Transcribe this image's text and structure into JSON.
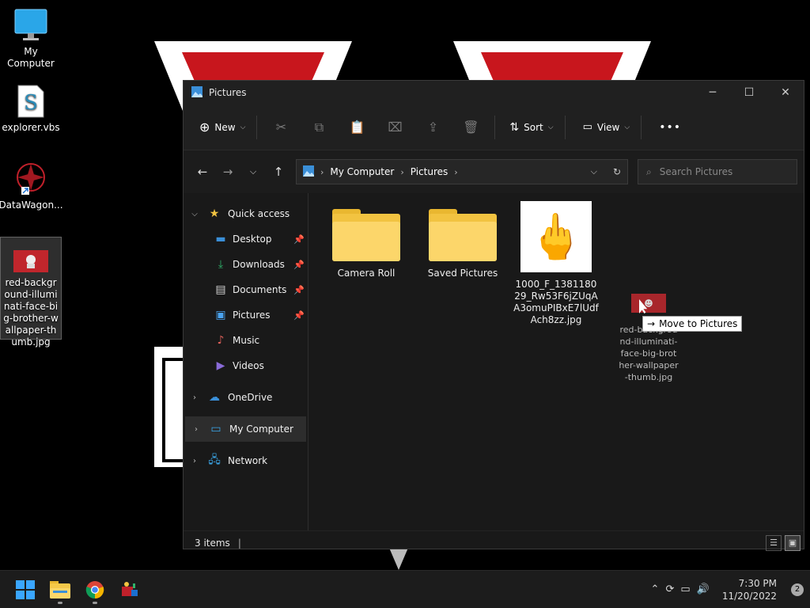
{
  "desktop": {
    "icons": [
      {
        "label": "My Computer",
        "icon": "monitor-icon"
      },
      {
        "label": "explorer.vbs",
        "icon": "script-file-icon"
      },
      {
        "label": "DataWagon...",
        "icon": "shortcut-icon"
      },
      {
        "label": "red-background-illuminati-face-big-brother-wallpaper-thumb.jpg",
        "icon": "image-file-icon"
      }
    ]
  },
  "window": {
    "title": "Pictures",
    "toolbar": {
      "new_label": "New",
      "sort_label": "Sort",
      "view_label": "View",
      "more_label": "•••"
    },
    "address": {
      "crumbs": [
        "My Computer",
        "Pictures"
      ]
    },
    "search": {
      "placeholder": "Search Pictures"
    },
    "sidebar": {
      "quick_access": "Quick access",
      "pinned": [
        {
          "label": "Desktop",
          "icon": "desktop-icon",
          "color": "#3a8fd8"
        },
        {
          "label": "Downloads",
          "icon": "download-icon",
          "color": "#2fb36a"
        },
        {
          "label": "Documents",
          "icon": "document-icon",
          "color": "#d0d0d0"
        },
        {
          "label": "Pictures",
          "icon": "picture-icon",
          "color": "#4aa3f0"
        },
        {
          "label": "Music",
          "icon": "music-icon",
          "color": "#e0605a"
        },
        {
          "label": "Videos",
          "icon": "video-icon",
          "color": "#8a6bd8"
        }
      ],
      "onedrive": "OneDrive",
      "my_computer": "My Computer",
      "network": "Network"
    },
    "files": [
      {
        "name": "Camera Roll",
        "type": "folder"
      },
      {
        "name": "Saved Pictures",
        "type": "folder"
      },
      {
        "name": "1000_F_138118029_Rw53F6jZUqAA3omuPIBxE7lUdfAch8zz.jpg",
        "type": "image"
      }
    ],
    "status": {
      "count": "3 items"
    }
  },
  "drag": {
    "ghost_label": "red-background-illuminati-face-big-brother-wallpaper-thumb.jpg",
    "tooltip": "Move to Pictures"
  },
  "taskbar": {
    "time": "7:30 PM",
    "date": "11/20/2022",
    "notifications": "2"
  }
}
